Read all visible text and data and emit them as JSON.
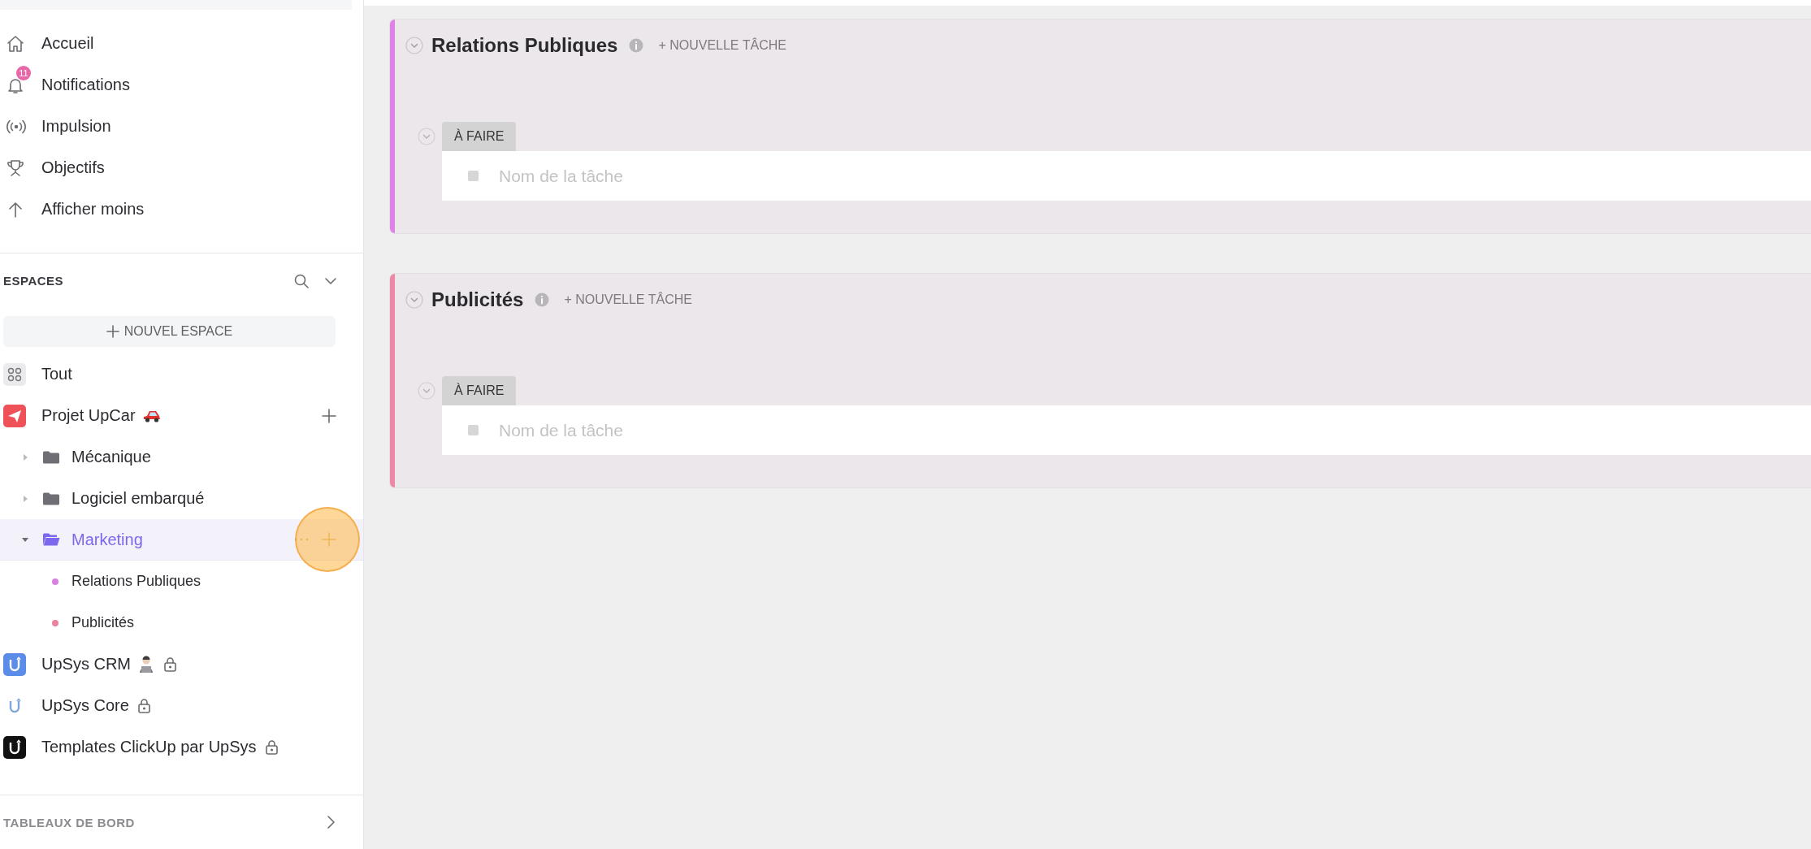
{
  "sidebar": {
    "nav": [
      {
        "kind": "home",
        "label": "Accueil"
      },
      {
        "kind": "bell",
        "label": "Notifications",
        "badge": "11"
      },
      {
        "kind": "pulse",
        "label": "Impulsion"
      },
      {
        "kind": "trophy",
        "label": "Objectifs"
      },
      {
        "kind": "arrow-up",
        "label": "Afficher moins"
      }
    ],
    "spaces_header": {
      "title": "ESPACES"
    },
    "new_space_button": {
      "label": "NOUVEL ESPACE"
    },
    "spaces": [
      {
        "kind": "all",
        "label": "Tout"
      },
      {
        "kind": "project",
        "color": "#ef5159",
        "label": "Projet UpCar",
        "locked": false,
        "children": [
          {
            "kind": "folder",
            "label": "Mécanique",
            "expanded": false,
            "selected": false
          },
          {
            "kind": "folder",
            "label": "Logiciel embarqué",
            "expanded": false,
            "selected": false
          },
          {
            "kind": "folder",
            "label": "Marketing",
            "expanded": true,
            "selected": true,
            "children": [
              {
                "kind": "list",
                "label": "Relations Publiques",
                "color": "#d97fe0"
              },
              {
                "kind": "list",
                "label": "Publicités",
                "color": "#e8829f"
              }
            ]
          }
        ]
      },
      {
        "kind": "team",
        "color": "#5b8ce8",
        "label": "UpSys CRM",
        "locked": true
      },
      {
        "kind": "space",
        "color": "#ffffff",
        "label": "UpSys Core",
        "locked": true
      },
      {
        "kind": "space",
        "color": "#111111",
        "label": "Templates ClickUp par UpSys",
        "locked": true
      }
    ],
    "dashboards": {
      "title": "TABLEAUX DE BORD"
    }
  },
  "lists": [
    {
      "title": "Relations Publiques",
      "color": "#df82e8",
      "add_task": "+ NOUVELLE TÂCHE",
      "groups": [
        {
          "status": "À FAIRE",
          "expanded": true,
          "placeholder": "Nom de la tâche"
        }
      ]
    },
    {
      "title": "Publicités",
      "color": "#ee88a8",
      "add_task": "+ NOUVELLE TÂCHE",
      "groups": [
        {
          "status": "À FAIRE",
          "expanded": true,
          "placeholder": "Nom de la tâche"
        }
      ]
    }
  ]
}
